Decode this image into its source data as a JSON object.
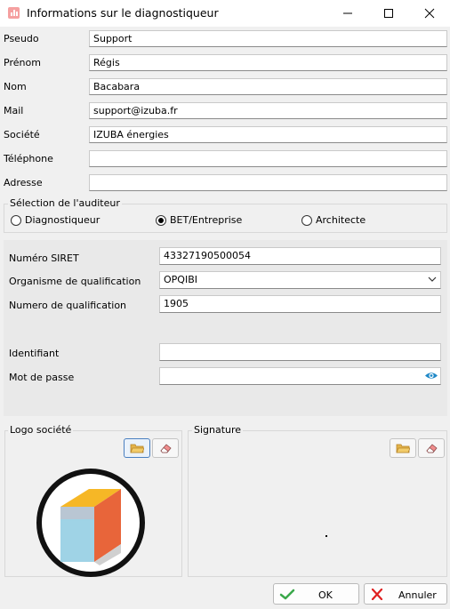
{
  "window": {
    "title": "Informations sur le diagnostiqueur",
    "accent": "#f5a0a0"
  },
  "fields": {
    "pseudo": {
      "label": "Pseudo",
      "value": "Support"
    },
    "prenom": {
      "label": "Prénom",
      "value": "Régis"
    },
    "nom": {
      "label": "Nom",
      "value": "Bacabara"
    },
    "mail": {
      "label": "Mail",
      "value": "support@izuba.fr"
    },
    "societe": {
      "label": "Société",
      "value": "IZUBA énergies"
    },
    "telephone": {
      "label": "Téléphone",
      "value": ""
    },
    "adresse": {
      "label": "Adresse",
      "value": ""
    }
  },
  "auditeur": {
    "legend": "Sélection de l'auditeur",
    "options": [
      {
        "label": "Diagnostiqueur",
        "selected": false
      },
      {
        "label": "BET/Entreprise",
        "selected": true
      },
      {
        "label": "Architecte",
        "selected": false
      }
    ]
  },
  "pro": {
    "siret": {
      "label": "Numéro SIRET",
      "value": "43327190500054"
    },
    "organisme": {
      "label": "Organisme de qualification",
      "value": "OPQIBI"
    },
    "numero": {
      "label": "Numero de qualification",
      "value": "1905"
    },
    "identifiant": {
      "label": "Identifiant",
      "value": ""
    },
    "motdepasse": {
      "label": "Mot de passe",
      "value": ""
    }
  },
  "logo": {
    "legend": "Logo société"
  },
  "signature": {
    "legend": "Signature"
  },
  "buttons": {
    "ok": "OK",
    "cancel": "Annuler"
  }
}
